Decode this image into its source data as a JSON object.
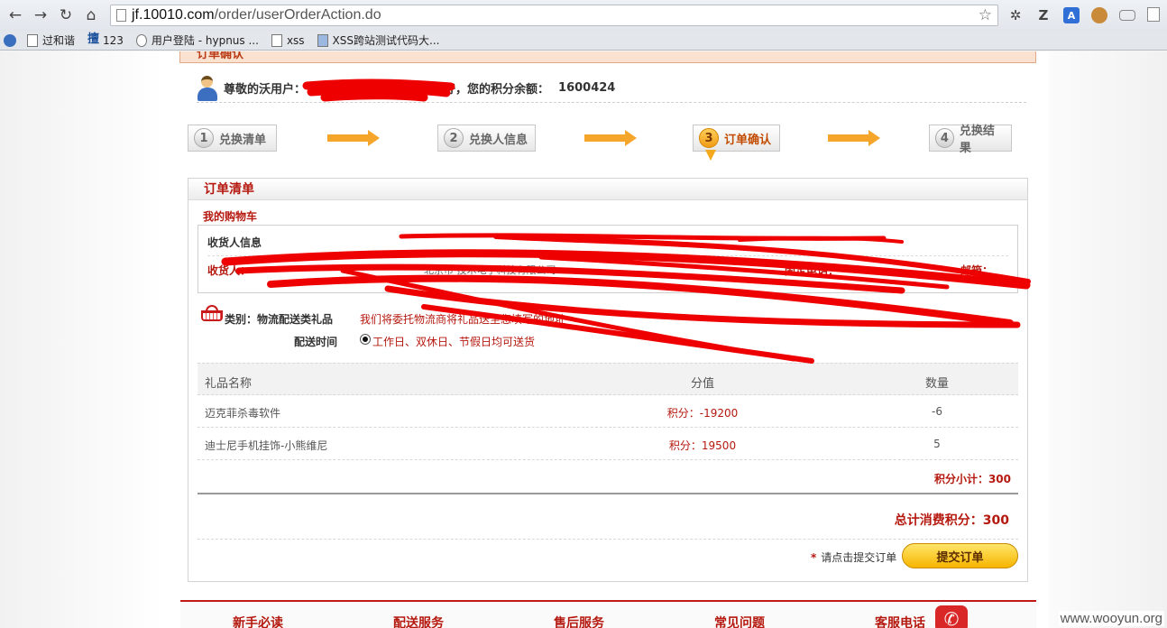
{
  "browser": {
    "url_host": "jf.10010.com",
    "url_path": "/order/userOrderAction.do",
    "bookmarks": [
      {
        "label": "过和谐"
      },
      {
        "label": "123"
      },
      {
        "label": "用户登陆 - hypnus ..."
      },
      {
        "label": "xss"
      },
      {
        "label": "XSS跨站测试代码大..."
      }
    ]
  },
  "page": {
    "section_title": "订单确认",
    "greeting_prefix": "尊敬的沃用户：",
    "greeting_suffix": "您好，您的积分余额：",
    "points_balance": "1600424",
    "steps": [
      {
        "num": "1",
        "label": "兑换清单"
      },
      {
        "num": "2",
        "label": "兑换人信息"
      },
      {
        "num": "3",
        "label": "订单确认"
      },
      {
        "num": "4",
        "label": "兑换结果"
      }
    ],
    "order": {
      "title": "订单清单",
      "cart_title": "我的购物车",
      "receiver_title": "收货人信息",
      "receiver_label": "收货人：",
      "receiver_partial": "北京市 技术电子科技有限公司",
      "phone_label": "固定电话：",
      "email_label": "邮箱：",
      "category_label": "类别：物流配送类礼品",
      "category_note": "我们将委托物流商将礼品送至您填写的地址",
      "delivery_label": "配送时间",
      "delivery_value": "工作日、双休日、节假日均可送货",
      "table_headers": {
        "name": "礼品名称",
        "value": "分值",
        "qty": "数量"
      },
      "items": [
        {
          "name": "迈克菲杀毒软件",
          "value": "积分：-19200",
          "qty": "-6"
        },
        {
          "name": "迪士尼手机挂饰-小熊维尼",
          "value": "积分：19500",
          "qty": "5"
        }
      ],
      "subtotal": "积分小计：300",
      "total": "总计消费积分：300",
      "submit_note": "请点击提交订单",
      "submit_button": "提交订单"
    },
    "footer": [
      "新手必读",
      "配送服务",
      "售后服务",
      "常见问题",
      "客服电话"
    ],
    "watermark": "www.wooyun.org"
  },
  "colors": {
    "accent_red": "#b5180e",
    "step_orange": "#f4a52a",
    "button_yellow": "#f7b500"
  }
}
